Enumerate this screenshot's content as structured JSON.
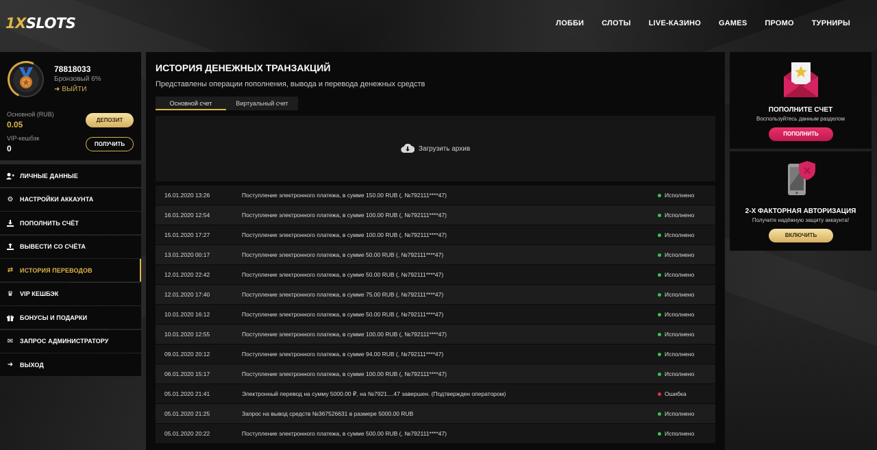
{
  "header": {
    "logo_prefix": "1X",
    "logo_main": "SLOTS",
    "nav": [
      "ЛОББИ",
      "СЛОТЫ",
      "LIVE-КАЗИНО",
      "GAMES",
      "ПРОМО",
      "ТУРНИРЫ"
    ]
  },
  "profile": {
    "user_id": "78818033",
    "rank": "Бронзовый 6%",
    "logout": "ВЫЙТИ",
    "balance_label": "Основной (RUB)",
    "balance_value": "0.05",
    "deposit_button": "ДЕПОЗИТ",
    "cashback_label": "VIP-кешбэк",
    "cashback_value": "0",
    "get_button": "ПОЛУЧИТЬ"
  },
  "menu": [
    {
      "label": "ЛИЧНЫЕ ДАННЫЕ",
      "icon": "user-plus-icon"
    },
    {
      "label": "НАСТРОЙКИ АККАУНТА",
      "icon": "gears-icon"
    },
    {
      "label": "ПОПОЛНИТЬ СЧЁТ",
      "icon": "download-icon"
    },
    {
      "label": "ВЫВЕСТИ СО СЧЁТА",
      "icon": "upload-icon"
    },
    {
      "label": "ИСТОРИЯ ПЕРЕВОДОВ",
      "icon": "transfer-icon"
    },
    {
      "label": "VIP КЕШБЭК",
      "icon": "crown-icon"
    },
    {
      "label": "БОНУСЫ И ПОДАРКИ",
      "icon": "gift-icon"
    },
    {
      "label": "ЗАПРОС АДМИНИСТРАТОРУ",
      "icon": "envelope-icon"
    },
    {
      "label": "ВЫХОД",
      "icon": "sign-out-icon"
    }
  ],
  "main": {
    "title": "ИСТОРИЯ ДЕНЕЖНЫХ ТРАНЗАКЦИЙ",
    "subtitle": "Представлены операции пополнения, вывода и перевода денежных средств",
    "tabs": [
      "Основной счет",
      "Виртуальный счет"
    ],
    "archive_label": "Загрузить архив",
    "rows": [
      {
        "date": "16.01.2020 13:26",
        "desc": "Поступление электронного платежа, в сумме 150.00 RUB (, №792111****47)",
        "status": "Исполнено"
      },
      {
        "date": "16.01.2020 12:54",
        "desc": "Поступление электронного платежа, в сумме 100.00 RUB (, №792111****47)",
        "status": "Исполнено"
      },
      {
        "date": "15.01.2020 17:27",
        "desc": "Поступление электронного платежа, в сумме 100.00 RUB (, №792111****47)",
        "status": "Исполнено"
      },
      {
        "date": "13.01.2020 00:17",
        "desc": "Поступление электронного платежа, в сумме 50.00 RUB (, №792111****47)",
        "status": "Исполнено"
      },
      {
        "date": "12.01.2020 22:42",
        "desc": "Поступление электронного платежа, в сумме 50.00 RUB (, №792111****47)",
        "status": "Исполнено"
      },
      {
        "date": "12.01.2020 17:40",
        "desc": "Поступление электронного платежа, в сумме 75.00 RUB (, №792111****47)",
        "status": "Исполнено"
      },
      {
        "date": "10.01.2020 16:12",
        "desc": "Поступление электронного платежа, в сумме 50.00 RUB (, №792111****47)",
        "status": "Исполнено"
      },
      {
        "date": "10.01.2020 12:55",
        "desc": "Поступление электронного платежа, в сумме 100.00 RUB (, №792111****47)",
        "status": "Исполнено"
      },
      {
        "date": "09.01.2020 20:12",
        "desc": "Поступление электронного платежа, в сумме 94.00 RUB (, №792111****47)",
        "status": "Исполнено"
      },
      {
        "date": "06.01.2020 15:17",
        "desc": "Поступление электронного платежа, в сумме 100.00 RUB (, №792111****47)",
        "status": "Исполнено"
      },
      {
        "date": "05.01.2020 21:41",
        "desc": "Электронный перевод на сумму 5000.00 ₽, на №7921....47 завершен. (Подтвержден оператором)",
        "status": "Ошибка"
      },
      {
        "date": "05.01.2020 21:25",
        "desc": "Запрос на вывод средств №367526631 в размере 5000.00 RUB",
        "status": "Исполнено"
      },
      {
        "date": "05.01.2020 20:22",
        "desc": "Поступление электронного платежа, в сумме 500.00 RUB (, №792111****47)",
        "status": "Исполнено"
      }
    ]
  },
  "cards": [
    {
      "title": "ПОПОЛНИТЕ СЧЕТ",
      "text": "Воспользуйтесь данным разделом",
      "button": "ПОПОЛНИТЬ"
    },
    {
      "title": "2-Х ФАКТОРНАЯ АВТОРИЗАЦИЯ",
      "text": "Получите надёжную защиту аккаунта!",
      "button": "ВКЛЮЧИТЬ"
    }
  ],
  "colors": {
    "accent": "#e0b54a",
    "pink": "#d62460",
    "success": "#2ecc4a",
    "error": "#e6304a"
  }
}
